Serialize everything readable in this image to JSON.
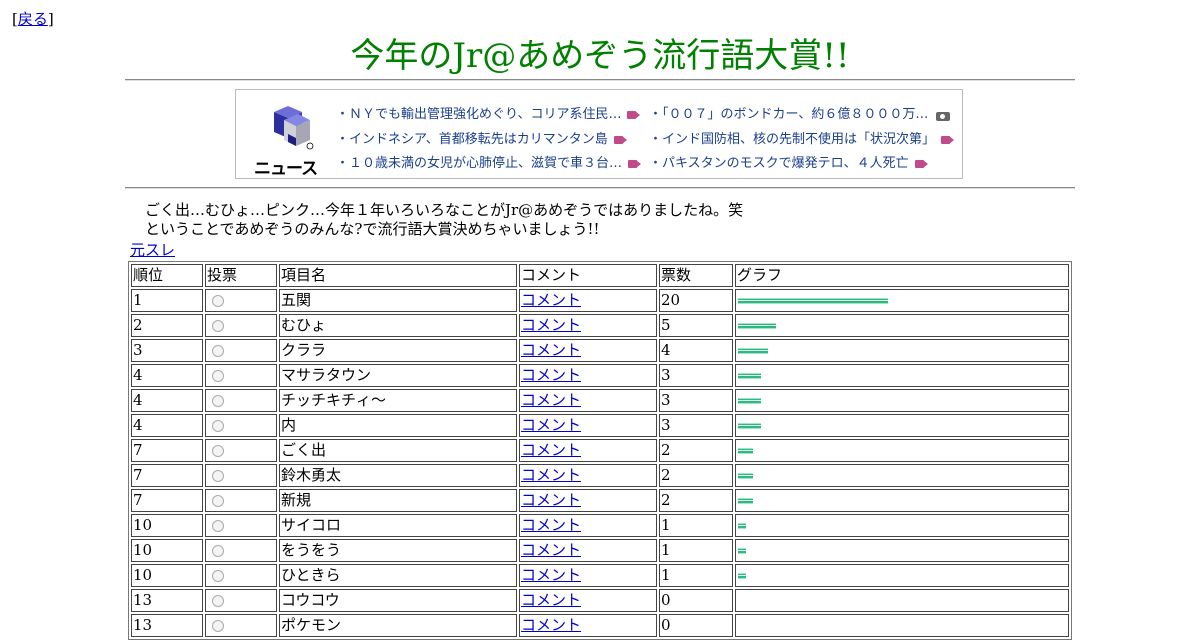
{
  "back_link": "戻る",
  "title": "今年のJr@あめぞう流行語大賞!!",
  "news": {
    "logo_text": "ニュース",
    "left": [
      {
        "text": "・ＮＹでも輸出管理強化めぐり、コリア系住民…",
        "icon": "video-icon"
      },
      {
        "text": "・インドネシア、首都移転先はカリマンタン島",
        "icon": "video-icon"
      },
      {
        "text": "・１０歳未満の女児が心肺停止、滋賀で車３台…",
        "icon": "video-icon"
      }
    ],
    "right": [
      {
        "text": "・「００７」のボンドカー、約６億８０００万…",
        "icon": "camera-icon"
      },
      {
        "text": "・インド国防相、核の先制不使用は「状況次第」",
        "icon": "video-icon"
      },
      {
        "text": "・パキスタンのモスクで爆発テロ、４人死亡",
        "icon": "video-icon"
      }
    ]
  },
  "intro": {
    "line1": "ごく出…むひょ…ピンク…今年１年いろいろなことがJr@あめぞうではありましたね。笑",
    "line2": "ということであめぞうのみんな?で流行語大賞決めちゃいましょう!!"
  },
  "motosure_link": "元スレ",
  "table": {
    "headers": [
      "順位",
      "投票",
      "項目名",
      "コメント",
      "票数",
      "グラフ"
    ],
    "comment_link": "コメント",
    "max_votes": 20,
    "rows": [
      {
        "rank": "1",
        "name": "五関",
        "votes": "20"
      },
      {
        "rank": "2",
        "name": "むひょ",
        "votes": "5"
      },
      {
        "rank": "3",
        "name": "クララ",
        "votes": "4"
      },
      {
        "rank": "4",
        "name": "マサラタウン",
        "votes": "3"
      },
      {
        "rank": "4",
        "name": "チッチキチィ～",
        "votes": "3"
      },
      {
        "rank": "4",
        "name": "内",
        "votes": "3"
      },
      {
        "rank": "7",
        "name": "ごく出",
        "votes": "2"
      },
      {
        "rank": "7",
        "name": "鈴木勇太",
        "votes": "2"
      },
      {
        "rank": "7",
        "name": "新規",
        "votes": "2"
      },
      {
        "rank": "10",
        "name": "サイコロ",
        "votes": "1"
      },
      {
        "rank": "10",
        "name": "をうをう",
        "votes": "1"
      },
      {
        "rank": "10",
        "name": "ひときら",
        "votes": "1"
      },
      {
        "rank": "13",
        "name": "コウコウ",
        "votes": "0"
      },
      {
        "rank": "13",
        "name": "ポケモン",
        "votes": "0"
      }
    ]
  }
}
